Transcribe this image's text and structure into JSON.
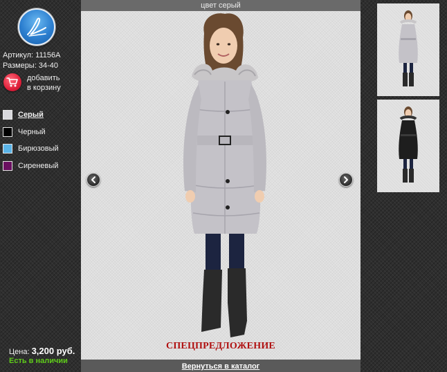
{
  "product": {
    "article_label": "Артикул:",
    "article_value": "11156A",
    "sizes_label": "Размеры:",
    "sizes_value": "34-40",
    "cart_label_line1": "добавить",
    "cart_label_line2": "в корзину",
    "price_label": "Цена:",
    "price_value": "3,200 руб.",
    "stock_status": "Есть в наличии"
  },
  "colors": [
    {
      "label": "Серый",
      "swatch": "#d8d8dc",
      "active": true
    },
    {
      "label": "Черный",
      "swatch": "#000000",
      "active": false
    },
    {
      "label": "Бирюзовый",
      "swatch": "#5ab4e8",
      "active": false
    },
    {
      "label": "Сиреневый",
      "swatch": "#6a1060",
      "active": false
    }
  ],
  "viewer": {
    "caption": "цвет серый",
    "special_offer": "СПЕЦПРЕДЛОЖЕНИЕ",
    "back_link": "Вернуться в каталог"
  },
  "icons": {
    "logo": "logo-emblem-icon",
    "cart": "shopping-cart-icon",
    "prev": "chevron-left-icon",
    "next": "chevron-right-icon"
  },
  "theme": {
    "price_accent": "#ffffff",
    "stock_color": "#5fcc1a",
    "special_color": "#b01010"
  }
}
